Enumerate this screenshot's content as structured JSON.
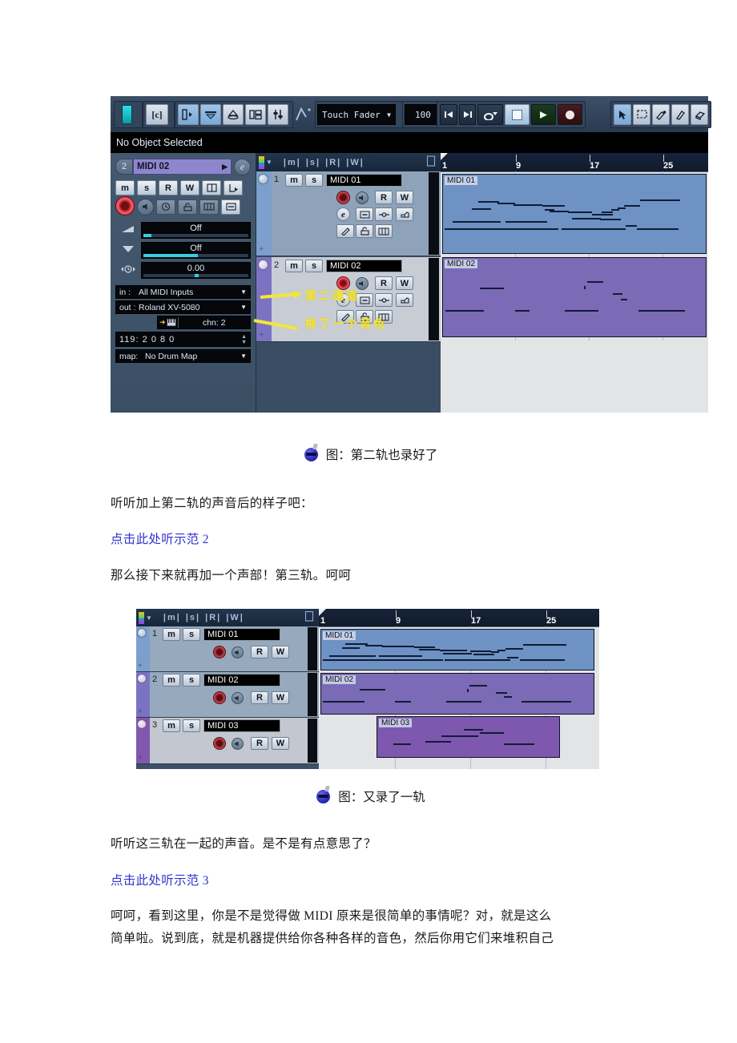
{
  "app": {
    "object_status": "No Object Selected",
    "automation_mode": "Touch Fader",
    "automation_time": "100 ms"
  },
  "toolbar": {
    "icons": [
      {
        "name": "constrain-delay-icon",
        "label": "|"
      },
      {
        "name": "show-info-icon",
        "label": "[e]"
      },
      {
        "name": "show-inspector-icon",
        "label": ""
      },
      {
        "name": "show-event-infoline-icon",
        "label": ""
      },
      {
        "name": "show-overview-icon",
        "label": ""
      },
      {
        "name": "show-tracklist-icon",
        "label": ""
      },
      {
        "name": "show-mixer-icon",
        "label": ""
      }
    ],
    "transport": [
      "go-to-start",
      "go-to-end",
      "cycle",
      "stop",
      "play",
      "record"
    ],
    "tools": [
      "arrow-tool",
      "range-tool",
      "glue-tool",
      "erase-tool",
      "zoom-tool"
    ]
  },
  "inspector": {
    "track_number": "2",
    "track_name": "MIDI 02",
    "row1_buttons": [
      "m",
      "s",
      "R",
      "W",
      "lanes",
      "output-route"
    ],
    "row2_buttons": [
      "record-enable",
      "monitor",
      "timebase",
      "lock",
      "edit-channel",
      "edit-instrument"
    ],
    "params": [
      {
        "icon": "fade-in-icon",
        "label": "Off",
        "fill": 8
      },
      {
        "icon": "fade-out-icon",
        "label": "Off",
        "fill": 52
      },
      {
        "icon": "delay-icon",
        "label": "0.00",
        "fill": 50
      }
    ],
    "routing": [
      {
        "key": "in :",
        "value": "All MIDI Inputs"
      },
      {
        "key": "out :",
        "value": "Roland XV-5080"
      }
    ],
    "channel_label": "chn: 2",
    "program": "119: 2 0 8 0",
    "drum_map": {
      "key": "map:",
      "value": "No Drum Map"
    }
  },
  "tracklist_header": {
    "columns": [
      "|m|",
      "|s|",
      "|R|",
      "|W|"
    ],
    "width_toggle": "resize-handle"
  },
  "shot1": {
    "tracks": [
      {
        "number": "1",
        "name": "MIDI 01",
        "color": "#6e92c4",
        "selected": false,
        "buttons": [
          "m",
          "s"
        ],
        "row2": [
          "record",
          "monitor",
          "R",
          "W"
        ],
        "row3": [
          "e",
          "in-transform",
          "out-transform",
          "channel"
        ],
        "row4": [
          "draw",
          "lock",
          "keys"
        ]
      },
      {
        "number": "2",
        "name": "MIDI 02",
        "color": "#7b73c2",
        "selected": true,
        "buttons": [
          "m",
          "s"
        ],
        "row2": [
          "record",
          "monitor",
          "R",
          "W"
        ],
        "row3": [
          "e",
          "in-transform",
          "out-transform",
          "channel"
        ],
        "row4": [
          "draw",
          "lock",
          "keys"
        ]
      }
    ],
    "ruler_ticks": [
      "1",
      "9",
      "17",
      "25"
    ],
    "parts": [
      {
        "label": "MIDI 01",
        "color": "#6e92c4"
      },
      {
        "label": "MIDI 02",
        "color": "#7b6ab5"
      }
    ],
    "annotations": [
      {
        "text": "第二通道",
        "name": "annotation-second-channel"
      },
      {
        "text": "换了一个音色",
        "name": "annotation-changed-timbre"
      }
    ]
  },
  "shot2": {
    "ruler_ticks": [
      "1",
      "9",
      "17",
      "25"
    ],
    "tracks": [
      {
        "number": "1",
        "name": "MIDI 01",
        "color": "#7d9fcd",
        "buttons": [
          "m",
          "s"
        ],
        "row2": [
          "record",
          "monitor",
          "R",
          "W"
        ]
      },
      {
        "number": "2",
        "name": "MIDI 02",
        "color": "#7b73c2",
        "buttons": [
          "m",
          "s"
        ],
        "row2": [
          "record",
          "monitor",
          "R",
          "W"
        ]
      },
      {
        "number": "3",
        "name": "MIDI 03",
        "color": "#8258ad",
        "buttons": [
          "m",
          "s"
        ],
        "row2": [
          "record",
          "monitor",
          "R",
          "W"
        ]
      }
    ],
    "parts": [
      {
        "label": "MIDI 01",
        "color": "#6e92c4"
      },
      {
        "label": "MIDI 02",
        "color": "#7b6ab5"
      },
      {
        "label": "MIDI 03",
        "color": "#7e58ae"
      }
    ]
  },
  "document": {
    "caption1": "图：第二轨也录好了",
    "para1": "听听加上第二轨的声音后的样子吧：",
    "link1": "点击此处听示范 2",
    "para2": "那么接下来就再加一个声部！第三轨。呵呵",
    "caption2": "图：又录了一轨",
    "para3": "听听这三轨在一起的声音。是不是有点意思了？",
    "link2": "点击此处听示范 3",
    "para4_line1": "呵呵，看到这里，你是不是觉得做 MIDI 原来是很简单的事情呢？对，就是这么",
    "para4_line2": "简单啦。说到底，就是机器提供给你各种各样的音色，然后你用它们来堆积自己"
  },
  "colors": {
    "link": "#3131cf",
    "annotation": "#f5e53b",
    "track1": "#6e92c4",
    "track2": "#7b6ab5",
    "track3": "#7e58ae"
  }
}
